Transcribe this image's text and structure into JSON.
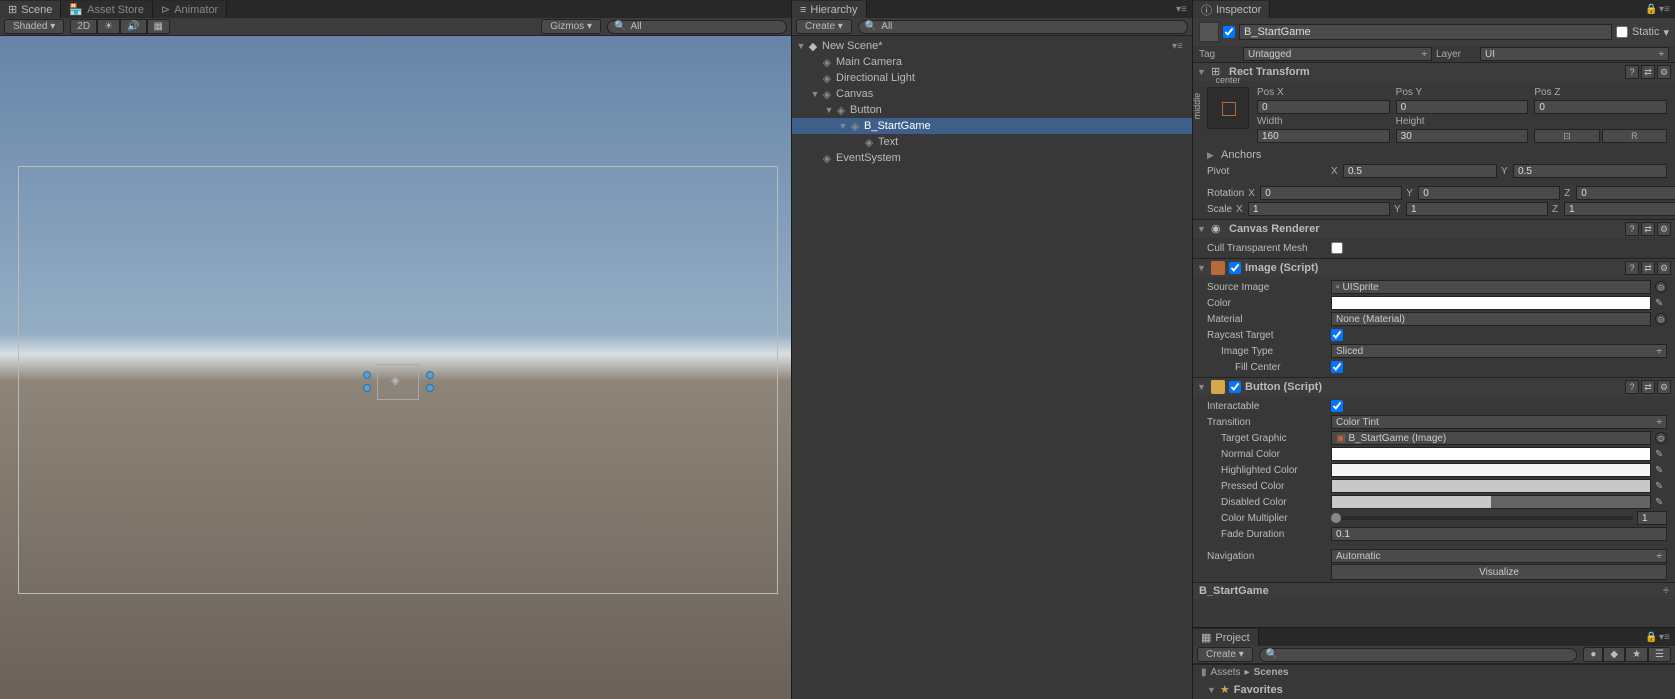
{
  "sceneTabs": {
    "scene": "Scene",
    "assetStore": "Asset Store",
    "animator": "Animator"
  },
  "sceneToolbar": {
    "shaded": "Shaded",
    "mode2d": "2D",
    "gizmos": "Gizmos",
    "searchAll": "All"
  },
  "hierarchy": {
    "title": "Hierarchy",
    "create": "Create",
    "searchAll": "All",
    "root": "New Scene*",
    "items": [
      {
        "label": "Main Camera",
        "indent": 1,
        "arrow": ""
      },
      {
        "label": "Directional Light",
        "indent": 1,
        "arrow": ""
      },
      {
        "label": "Canvas",
        "indent": 1,
        "arrow": "▼"
      },
      {
        "label": "Button",
        "indent": 2,
        "arrow": "▼"
      },
      {
        "label": "B_StartGame",
        "indent": 3,
        "arrow": "▼",
        "selected": true
      },
      {
        "label": "Text",
        "indent": 4,
        "arrow": ""
      },
      {
        "label": "EventSystem",
        "indent": 1,
        "arrow": ""
      }
    ]
  },
  "inspector": {
    "title": "Inspector",
    "objectName": "B_StartGame",
    "staticLabel": "Static",
    "tagLabel": "Tag",
    "tagValue": "Untagged",
    "layerLabel": "Layer",
    "layerValue": "UI",
    "rectTransform": {
      "title": "Rect Transform",
      "anchorH": "center",
      "anchorV": "middle",
      "posX": {
        "label": "Pos X",
        "value": "0"
      },
      "posY": {
        "label": "Pos Y",
        "value": "0"
      },
      "posZ": {
        "label": "Pos Z",
        "value": "0"
      },
      "width": {
        "label": "Width",
        "value": "160"
      },
      "height": {
        "label": "Height",
        "value": "30"
      },
      "rBtn": "R",
      "anchors": "Anchors",
      "pivot": {
        "label": "Pivot",
        "x": "0.5",
        "y": "0.5"
      },
      "rotation": {
        "label": "Rotation",
        "x": "0",
        "y": "0",
        "z": "0"
      },
      "scale": {
        "label": "Scale",
        "x": "1",
        "y": "1",
        "z": "1"
      }
    },
    "canvasRenderer": {
      "title": "Canvas Renderer",
      "cullTransparent": "Cull Transparent Mesh"
    },
    "image": {
      "title": "Image (Script)",
      "sourceImage": {
        "label": "Source Image",
        "value": "UISprite"
      },
      "color": "Color",
      "material": {
        "label": "Material",
        "value": "None (Material)"
      },
      "raycastTarget": "Raycast Target",
      "imageType": {
        "label": "Image Type",
        "value": "Sliced"
      },
      "fillCenter": "Fill Center"
    },
    "button": {
      "title": "Button (Script)",
      "interactable": "Interactable",
      "transition": {
        "label": "Transition",
        "value": "Color Tint"
      },
      "targetGraphic": {
        "label": "Target Graphic",
        "value": "B_StartGame (Image)"
      },
      "normalColor": "Normal Color",
      "highlightedColor": "Highlighted Color",
      "pressedColor": "Pressed Color",
      "disabledColor": "Disabled Color",
      "colorMultiplier": {
        "label": "Color Multiplier",
        "value": "1"
      },
      "fadeDuration": {
        "label": "Fade Duration",
        "value": "0.1"
      },
      "navigation": {
        "label": "Navigation",
        "value": "Automatic"
      },
      "visualize": "Visualize"
    },
    "footer": "B_StartGame"
  },
  "project": {
    "title": "Project",
    "create": "Create",
    "favorites": "Favorites",
    "breadcrumb": {
      "assets": "Assets",
      "scenes": "Scenes"
    }
  },
  "labels": {
    "x": "X",
    "y": "Y",
    "z": "Z"
  }
}
